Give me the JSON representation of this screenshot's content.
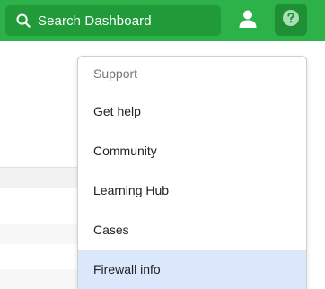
{
  "header": {
    "search_label": "Search Dashboard",
    "search_icon": "search-icon",
    "user_icon": "user-icon",
    "help_icon": "help-icon",
    "bar_color": "#2db24a"
  },
  "support_menu": {
    "title": "Support",
    "items": [
      {
        "label": "Get help",
        "active": false
      },
      {
        "label": "Community",
        "active": false
      },
      {
        "label": "Learning Hub",
        "active": false
      },
      {
        "label": "Cases",
        "active": false
      },
      {
        "label": "Firewall info",
        "active": true
      }
    ],
    "highlight_color": "#dbe7fb"
  }
}
